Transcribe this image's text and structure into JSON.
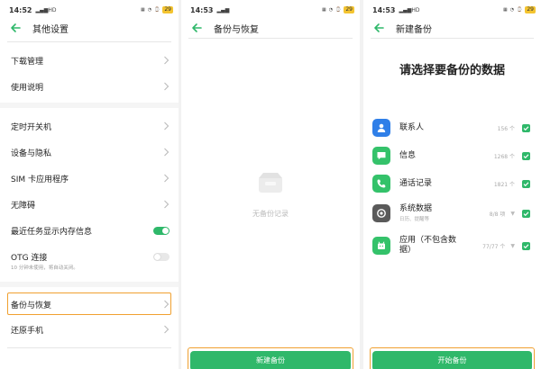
{
  "colors": {
    "accent": "#2fb86a",
    "highlight": "#f0a030",
    "battery": "#f4c430"
  },
  "screen1": {
    "status": {
      "time": "14:52",
      "network": "HD",
      "battery": "29"
    },
    "title": "其他设置",
    "items": [
      {
        "label": "下载管理"
      },
      {
        "label": "使用说明"
      },
      {
        "label": "定时开关机"
      },
      {
        "label": "设备与隐私"
      },
      {
        "label": "SIM 卡应用程序"
      },
      {
        "label": "无障碍"
      },
      {
        "label": "最近任务显示内存信息"
      },
      {
        "label": "OTG 连接",
        "sub": "10 分钟未使用，将自动关闭。"
      },
      {
        "label": "备份与恢复"
      },
      {
        "label": "还原手机"
      }
    ]
  },
  "screen2": {
    "status": {
      "time": "14:53",
      "battery": "29"
    },
    "title": "备份与恢复",
    "empty_text": "无备份记录",
    "button_label": "新建备份"
  },
  "screen3": {
    "status": {
      "time": "14:53",
      "network": "HD",
      "battery": "29"
    },
    "title": "新建备份",
    "heading": "请选择要备份的数据",
    "rows": [
      {
        "label": "联系人",
        "count": "156 个",
        "icon": "contacts-icon"
      },
      {
        "label": "信息",
        "count": "1268 个",
        "icon": "message-icon"
      },
      {
        "label": "通话记录",
        "count": "1821 个",
        "icon": "phone-icon"
      },
      {
        "label": "系统数据",
        "sub": "日历、提醒等",
        "count": "8/8 项",
        "icon": "settings-icon"
      },
      {
        "label": "应用（不包含数据）",
        "label_line1": "应用（不包含数",
        "label_line2": "据）",
        "count": "77/77 个",
        "icon": "apps-icon"
      }
    ],
    "button_label": "开始备份"
  }
}
